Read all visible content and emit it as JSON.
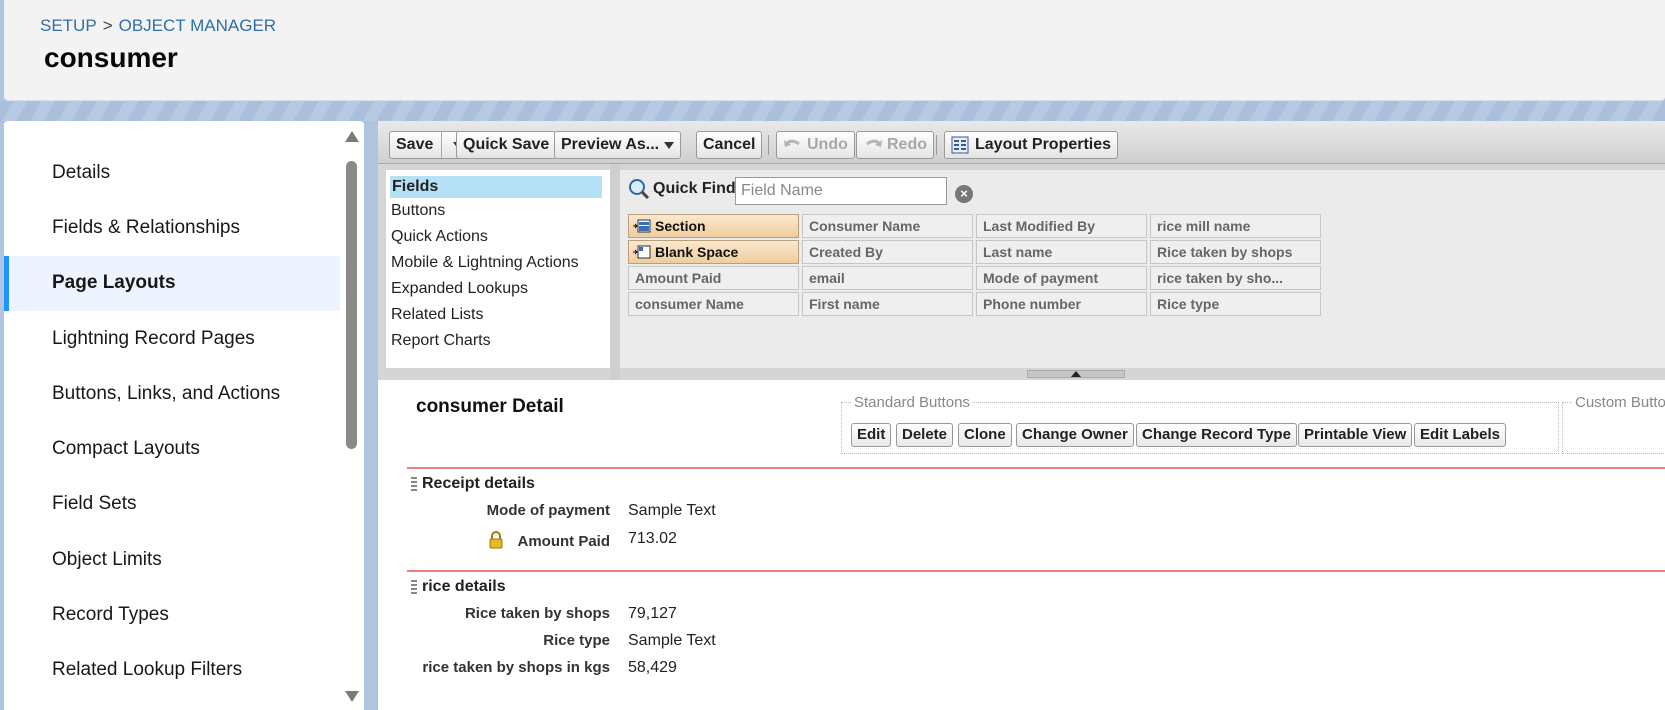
{
  "header": {
    "breadcrumb": [
      "SETUP",
      "OBJECT MANAGER"
    ],
    "breadcrumb_sep": ">",
    "title": "consumer"
  },
  "sidebar": {
    "active_index": 2,
    "items": [
      {
        "label": "Details"
      },
      {
        "label": "Fields & Relationships"
      },
      {
        "label": "Page Layouts"
      },
      {
        "label": "Lightning Record Pages"
      },
      {
        "label": "Buttons, Links, and Actions"
      },
      {
        "label": "Compact Layouts"
      },
      {
        "label": "Field Sets"
      },
      {
        "label": "Object Limits"
      },
      {
        "label": "Record Types"
      },
      {
        "label": "Related Lookup Filters"
      }
    ]
  },
  "toolbar": {
    "save": "Save",
    "quick_save": "Quick Save",
    "preview_as": "Preview As...",
    "cancel": "Cancel",
    "undo": "Undo",
    "redo": "Redo",
    "layout_properties": "Layout Properties"
  },
  "palette": {
    "categories": [
      "Fields",
      "Buttons",
      "Quick Actions",
      "Mobile & Lightning Actions",
      "Expanded Lookups",
      "Related Lists",
      "Report Charts"
    ],
    "quick_find_label": "Quick Find",
    "quick_find_placeholder": "Field Name",
    "fields": [
      [
        "Section",
        "Consumer Name",
        "Last Modified By",
        "rice mill name"
      ],
      [
        "Blank Space",
        "Created By",
        "Last name",
        "Rice taken by shops"
      ],
      [
        "Amount Paid",
        "email",
        "Mode of payment",
        "rice taken by sho..."
      ],
      [
        "consumer Name",
        "First name",
        "Phone number",
        "Rice type"
      ]
    ]
  },
  "canvas": {
    "detail_title": "consumer Detail",
    "standard_buttons_label": "Standard Buttons",
    "standard_buttons": [
      "Edit",
      "Delete",
      "Clone",
      "Change Owner",
      "Change Record Type",
      "Printable View",
      "Edit Labels"
    ],
    "custom_buttons_label": "Custom Butto",
    "sections": [
      {
        "title": "Receipt details",
        "rows": [
          {
            "label": "Mode of payment",
            "value": "Sample Text",
            "locked": false
          },
          {
            "label": "Amount Paid",
            "value": "713.02",
            "locked": true
          }
        ]
      },
      {
        "title": "rice details",
        "rows": [
          {
            "label": "Rice taken by shops",
            "value": "79,127",
            "locked": false
          },
          {
            "label": "Rice type",
            "value": "Sample Text",
            "locked": false
          },
          {
            "label": "rice taken by shops in kgs",
            "value": "58,429",
            "locked": false
          }
        ]
      }
    ]
  }
}
